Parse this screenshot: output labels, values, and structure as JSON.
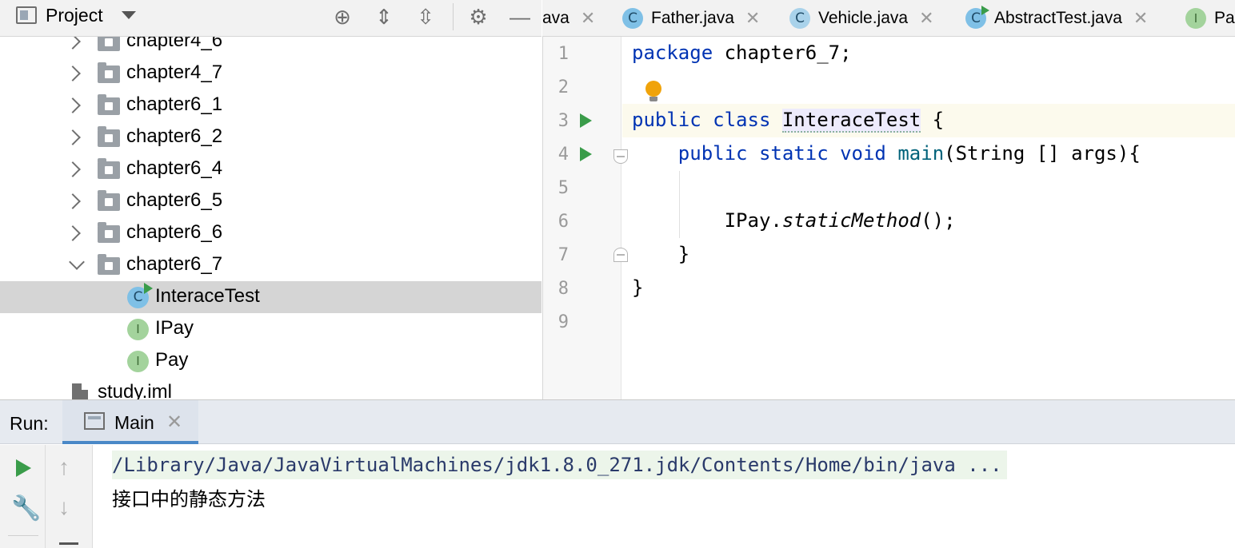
{
  "project_panel": {
    "title": "Project",
    "tree": [
      {
        "label": "chapter4_6",
        "type": "folder",
        "expanded": false
      },
      {
        "label": "chapter4_7",
        "type": "folder",
        "expanded": false
      },
      {
        "label": "chapter6_1",
        "type": "folder",
        "expanded": false
      },
      {
        "label": "chapter6_2",
        "type": "folder",
        "expanded": false
      },
      {
        "label": "chapter6_4",
        "type": "folder",
        "expanded": false
      },
      {
        "label": "chapter6_5",
        "type": "folder",
        "expanded": false
      },
      {
        "label": "chapter6_6",
        "type": "folder",
        "expanded": false
      },
      {
        "label": "chapter6_7",
        "type": "folder",
        "expanded": true
      },
      {
        "label": "InteraceTest",
        "type": "class",
        "selected": true,
        "icon_letter": "C"
      },
      {
        "label": "IPay",
        "type": "interface",
        "icon_letter": "I"
      },
      {
        "label": "Pay",
        "type": "interface",
        "icon_letter": "I"
      },
      {
        "label": "study.iml",
        "type": "file"
      }
    ]
  },
  "tabs": [
    {
      "label": "ava",
      "icon": "none"
    },
    {
      "label": "Father.java",
      "icon": "class-icon",
      "letter": "C"
    },
    {
      "label": "Vehicle.java",
      "icon": "abstract-class-icon",
      "letter": "C"
    },
    {
      "label": "AbstractTest.java",
      "icon": "runnable-class-icon",
      "letter": "C"
    },
    {
      "label": "Pa",
      "icon": "interface-icon",
      "letter": "I"
    }
  ],
  "editor": {
    "line_numbers": [
      "1",
      "2",
      "3",
      "4",
      "5",
      "6",
      "7",
      "8",
      "9"
    ],
    "code": {
      "l1_kw": "package",
      "l1_rest": " chapter6_7;",
      "l3_kw": "public class",
      "l3_cls": "InteraceTest",
      "l3_rest": " {",
      "l4_kw": "public static void",
      "l4_fn": "main",
      "l4_rest": "(String [] args){",
      "l6_obj": "IPay.",
      "l6_method": "staticMethod",
      "l6_rest": "();",
      "l7": "}",
      "l8": "}"
    }
  },
  "run_panel": {
    "label": "Run:",
    "tab_label": "Main",
    "console": {
      "command": "/Library/Java/JavaVirtualMachines/jdk1.8.0_271.jdk/Contents/Home/bin/java ...",
      "output": "接口中的静态方法"
    }
  },
  "colors": {
    "keyword": "#0033b3",
    "function": "#00627a",
    "selection": "#d5d5d5",
    "run_green": "#3a9c4a"
  }
}
